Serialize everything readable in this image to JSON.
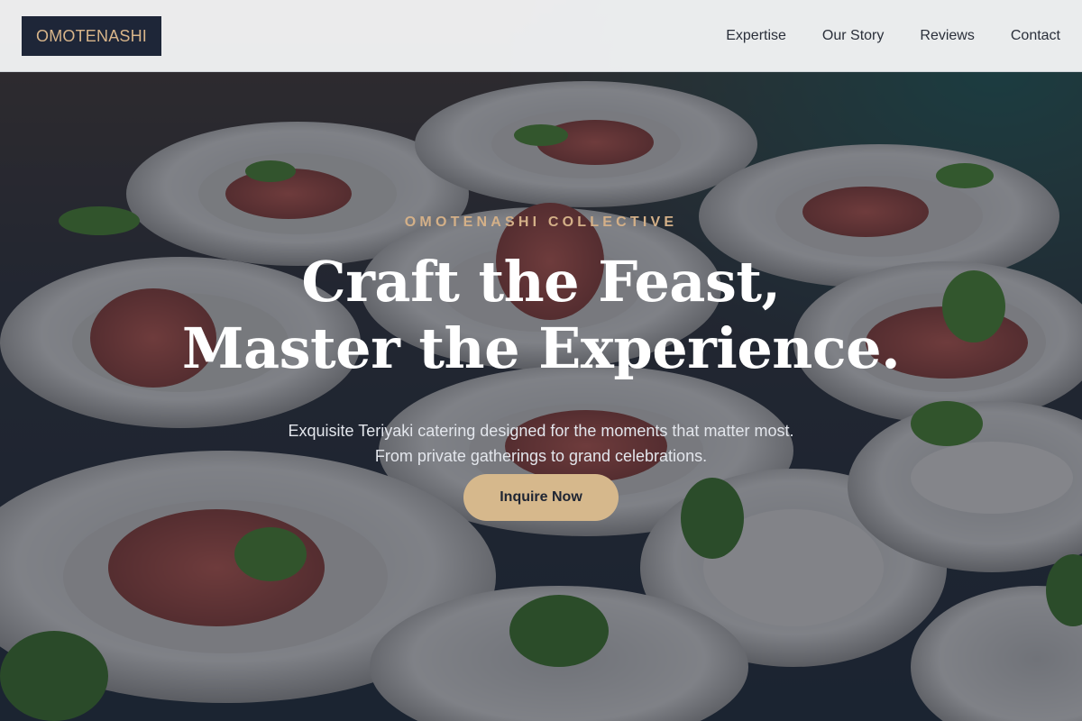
{
  "brand": {
    "logo_text": "OMOTENASHI"
  },
  "nav": {
    "items": [
      {
        "label": "Expertise"
      },
      {
        "label": "Our Story"
      },
      {
        "label": "Reviews"
      },
      {
        "label": "Contact"
      }
    ]
  },
  "hero": {
    "eyebrow": "OMOTENASHI COLLECTIVE",
    "headline_line1": "Craft the Feast,",
    "headline_line2": "Master the Experience.",
    "subtitle_line1": "Exquisite Teriyaki catering designed for the moments that matter most.",
    "subtitle_line2": "From private gatherings to grand celebrations.",
    "cta_label": "Inquire Now",
    "background_image": "plated-appetizers-photo"
  },
  "colors": {
    "accent_gold": "#d6b88c",
    "logo_bg": "#1e2638",
    "nav_bg": "#f3f4f5",
    "headline": "#ffffff"
  }
}
